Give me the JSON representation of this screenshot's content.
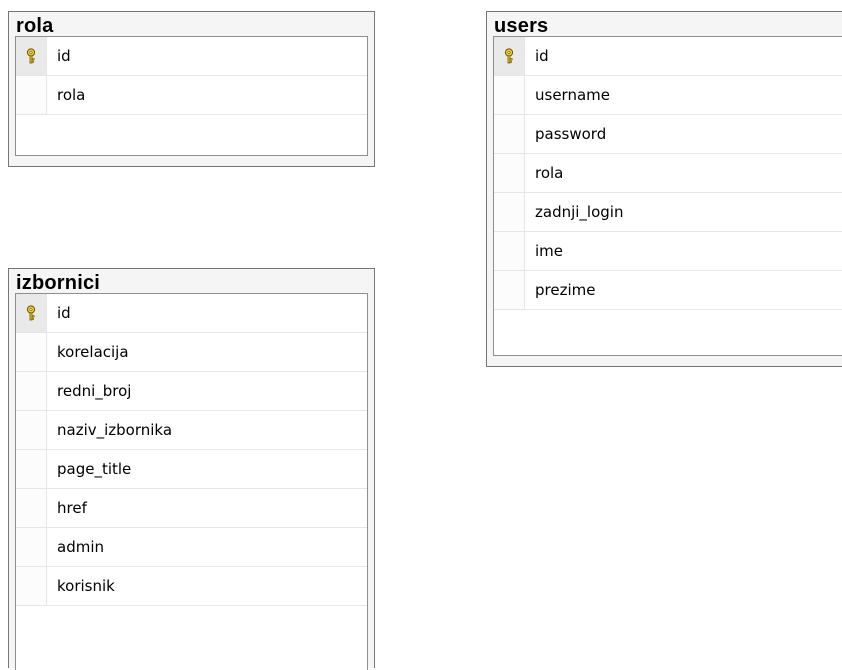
{
  "tables": [
    {
      "name": "rola",
      "columns": [
        {
          "name": "id",
          "primary_key": true
        },
        {
          "name": "rola",
          "primary_key": false
        }
      ]
    },
    {
      "name": "users",
      "columns": [
        {
          "name": "id",
          "primary_key": true
        },
        {
          "name": "username",
          "primary_key": false
        },
        {
          "name": "password",
          "primary_key": false
        },
        {
          "name": "rola",
          "primary_key": false
        },
        {
          "name": "zadnji_login",
          "primary_key": false
        },
        {
          "name": "ime",
          "primary_key": false
        },
        {
          "name": "prezime",
          "primary_key": false
        }
      ]
    },
    {
      "name": "izbornici",
      "columns": [
        {
          "name": "id",
          "primary_key": true
        },
        {
          "name": "korelacija",
          "primary_key": false
        },
        {
          "name": "redni_broj",
          "primary_key": false
        },
        {
          "name": "naziv_izbornika",
          "primary_key": false
        },
        {
          "name": "page_title",
          "primary_key": false
        },
        {
          "name": "href",
          "primary_key": false
        },
        {
          "name": "admin",
          "primary_key": false
        },
        {
          "name": "korisnik",
          "primary_key": false
        }
      ]
    }
  ],
  "icons": {
    "primary_key": "key-icon"
  },
  "colors": {
    "key_gold": "#e8c01a",
    "border": "#767676"
  }
}
